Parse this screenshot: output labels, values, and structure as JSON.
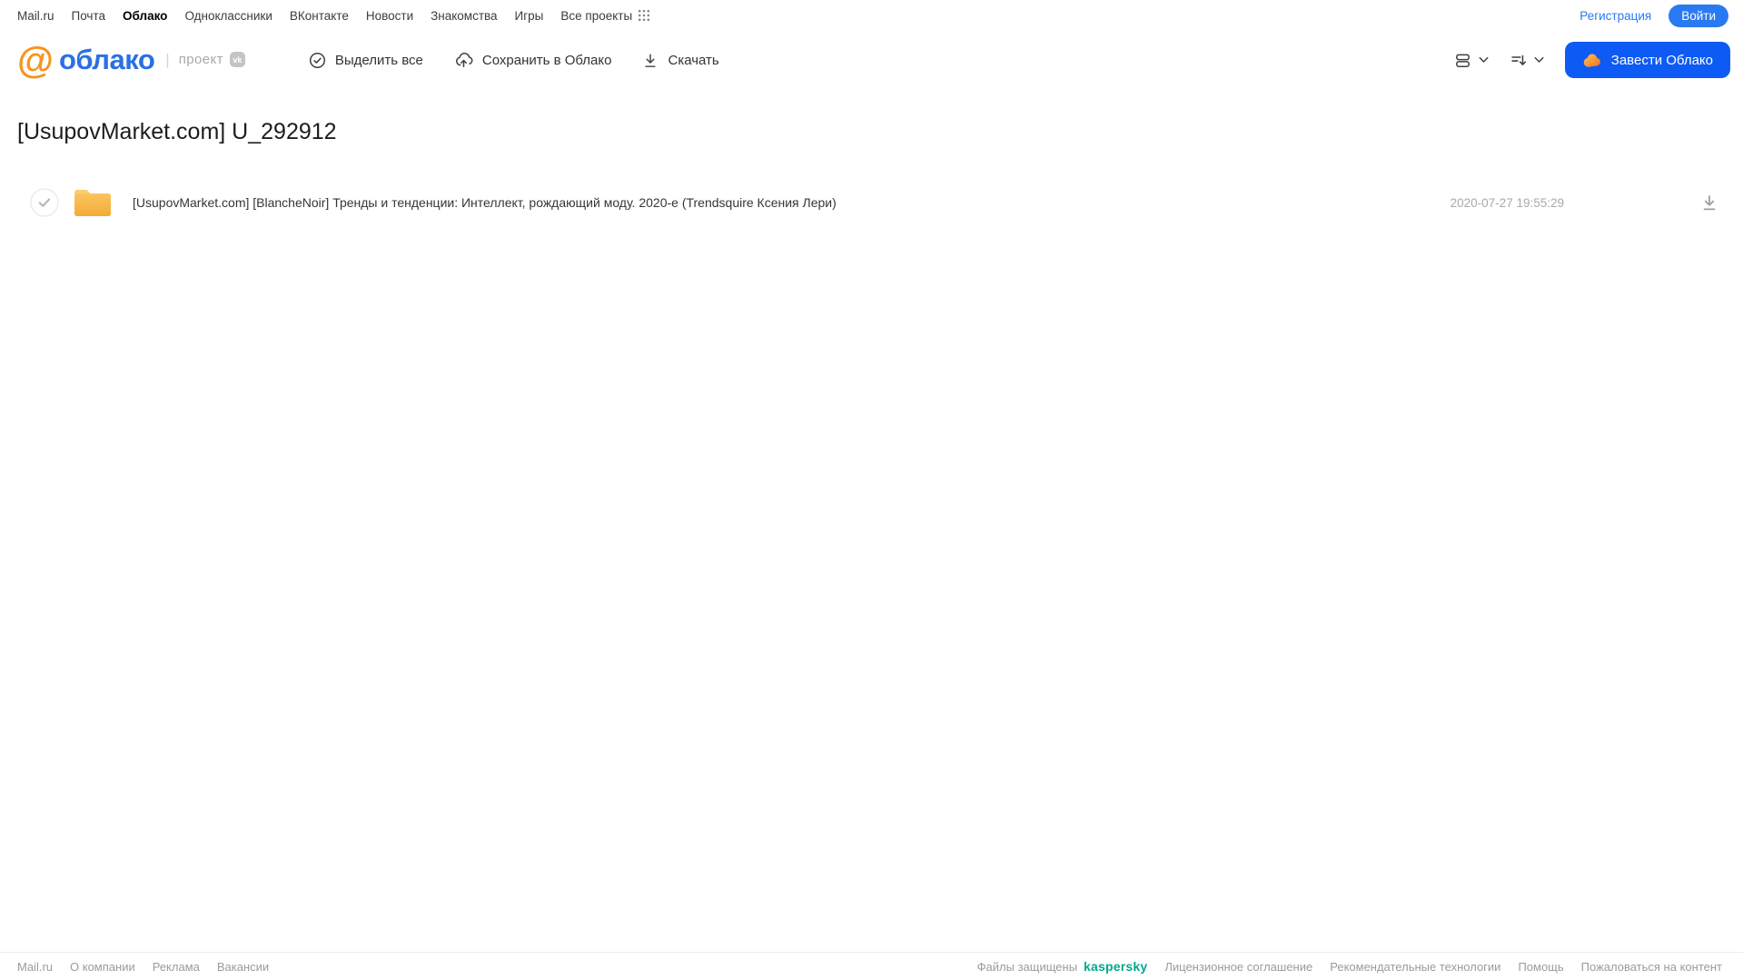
{
  "topnav": {
    "items": [
      "Mail.ru",
      "Почта",
      "Облако",
      "Одноклассники",
      "ВКонтакте",
      "Новости",
      "Знакомства",
      "Игры",
      "Все проекты"
    ],
    "registration_label": "Регистрация",
    "login_label": "Войти"
  },
  "header": {
    "logo": {
      "at_symbol": "@",
      "product_name": "облако",
      "separator": "|",
      "project_label": "проект",
      "vk_badge": "vk"
    },
    "toolbar": {
      "select_all": "Выделить все",
      "save_to_cloud": "Сохранить в Облако",
      "download": "Скачать"
    },
    "create_cloud_label": "Завести Облако"
  },
  "main": {
    "title": "[UsupovMarket.com] U_292912",
    "files": [
      {
        "name": "[UsupovMarket.com] [BlancheNoir] Тренды и тенденции: Интеллект, рождающий моду. 2020-е (Trendsquire Ксения Лери)",
        "modified": "2020-07-27 19:55:29"
      }
    ]
  },
  "footer": {
    "left_links": [
      "Mail.ru",
      "О компании",
      "Реклама",
      "Вакансии"
    ],
    "protected_by": "Файлы защищены",
    "kaspersky_label": "kaspersky",
    "right_links": [
      "Лицензионное соглашение",
      "Рекомендательные технологии",
      "Помощь",
      "Пожаловаться на контент"
    ]
  },
  "colors": {
    "accent_blue": "#2979F2",
    "button_blue": "#0D5AF5",
    "logo_blue": "#2B6FE5",
    "logo_orange": "#F7941E",
    "folder_yellow": "#F6B94A",
    "kaspersky_green": "#00A88E",
    "muted_gray": "#9B9B9B",
    "date_gray": "#A9A9A9"
  }
}
